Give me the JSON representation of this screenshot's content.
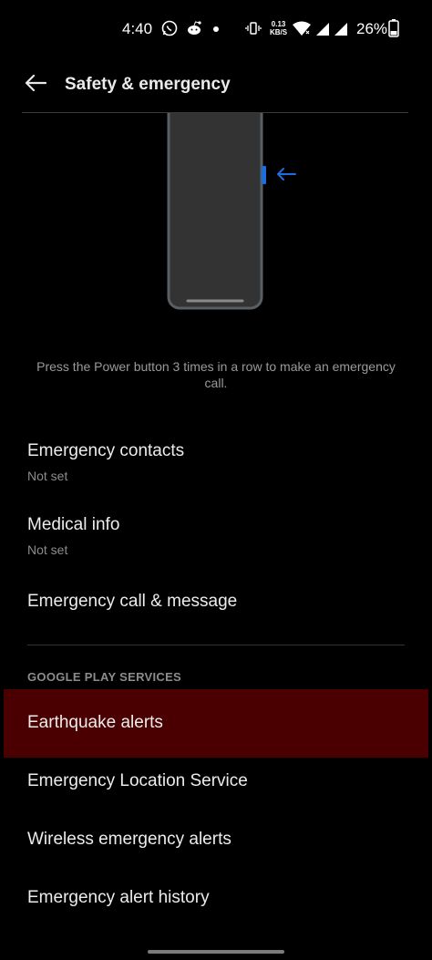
{
  "status_bar": {
    "time": "4:40",
    "speed_value": "0.13",
    "speed_unit": "KB/S",
    "battery": "26%",
    "icons": [
      "whatsapp-icon",
      "reddit-icon",
      "dot-icon",
      "vibrate-icon",
      "wifi-icon",
      "signal-icon",
      "battery-icon"
    ]
  },
  "header": {
    "title": "Safety & emergency",
    "back_icon": "arrow-left-icon"
  },
  "illustration": {
    "accent_color": "#1a6fe0",
    "phone_fill": "#3a3a3a",
    "phone_border": "#5a5f63"
  },
  "caption": "Press the Power button 3 times in a row to make an emergency call.",
  "settings": {
    "emergency_contacts": {
      "title": "Emergency contacts",
      "subtitle": "Not set"
    },
    "medical_info": {
      "title": "Medical info",
      "subtitle": "Not set"
    },
    "emergency_call_message": {
      "title": "Emergency call & message"
    }
  },
  "google_play_services": {
    "header": "GOOGLE PLAY SERVICES",
    "items": [
      {
        "title": "Earthquake alerts",
        "highlighted": true,
        "highlight_color": "#4a0000"
      },
      {
        "title": "Emergency Location Service"
      },
      {
        "title": "Wireless emergency alerts"
      },
      {
        "title": "Emergency alert history"
      }
    ]
  }
}
